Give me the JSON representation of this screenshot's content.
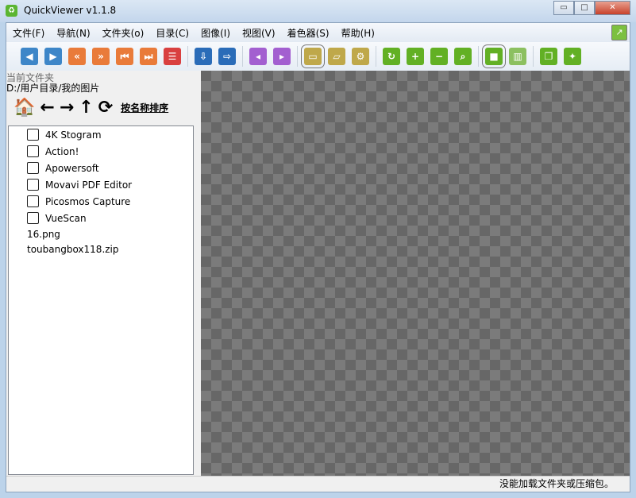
{
  "window": {
    "title": "QuickViewer v1.1.8",
    "minimize": "▭",
    "maximize": "□",
    "close": "✕"
  },
  "menu": [
    "文件(F)",
    "导航(N)",
    "文件夹(o)",
    "目录(C)",
    "图像(I)",
    "视图(V)",
    "着色器(S)",
    "帮助(H)"
  ],
  "menu_end_icon": "↗",
  "toolbar": [
    {
      "name": "prev-image",
      "glyph": "◀",
      "color": "#3d86c8"
    },
    {
      "name": "next-image",
      "glyph": "▶",
      "color": "#3d86c8"
    },
    {
      "name": "fast-back",
      "glyph": "«",
      "color": "#e97b3a"
    },
    {
      "name": "fast-forward",
      "glyph": "»",
      "color": "#e97b3a"
    },
    {
      "name": "first",
      "glyph": "⏮",
      "color": "#e97b3a"
    },
    {
      "name": "last",
      "glyph": "⏭",
      "color": "#e97b3a"
    },
    {
      "name": "catalog",
      "glyph": "☰",
      "color": "#d94040"
    },
    {
      "sep": true
    },
    {
      "name": "open-volume",
      "glyph": "⇩",
      "color": "#2a6cb8"
    },
    {
      "name": "export",
      "glyph": "⇨",
      "color": "#2a6cb8"
    },
    {
      "sep": true
    },
    {
      "name": "prev-volume",
      "glyph": "◂",
      "color": "#a35fd0"
    },
    {
      "name": "next-volume",
      "glyph": "▸",
      "color": "#a35fd0"
    },
    {
      "sep": true
    },
    {
      "name": "folder",
      "glyph": "▭",
      "color": "#bfa84a",
      "sel": true
    },
    {
      "name": "book",
      "glyph": "▱",
      "color": "#bfa84a"
    },
    {
      "name": "settings",
      "glyph": "⚙",
      "color": "#bfa84a"
    },
    {
      "sep": true
    },
    {
      "name": "rotate",
      "glyph": "↻",
      "color": "#62b024"
    },
    {
      "name": "zoom-in",
      "glyph": "+",
      "color": "#62b024"
    },
    {
      "name": "zoom-out",
      "glyph": "−",
      "color": "#62b024"
    },
    {
      "name": "magnifier",
      "glyph": "⌕",
      "color": "#62b024"
    },
    {
      "sep": true
    },
    {
      "name": "single-page",
      "glyph": "■",
      "color": "#62b024",
      "sel": true
    },
    {
      "name": "dual-page",
      "glyph": "▥",
      "color": "#8cc060"
    },
    {
      "sep": true
    },
    {
      "name": "fullscreen",
      "glyph": "❐",
      "color": "#62b024"
    },
    {
      "name": "pin",
      "glyph": "✦",
      "color": "#62b024"
    }
  ],
  "sidebar": {
    "label": "当前文件夹",
    "path": "D:/用户目录/我的图片",
    "nav": {
      "home": "🏠",
      "back": "←",
      "forward": "→",
      "up": "↑",
      "refresh": "⟳",
      "sort": "按名称排序"
    },
    "folders": [
      "4K Stogram",
      "Action!",
      "Apowersoft",
      "Movavi PDF Editor",
      "Picosmos Capture",
      "VueScan"
    ],
    "files": [
      "16.png",
      "toubangbox118.zip"
    ]
  },
  "status": "没能加载文件夹或压缩包。"
}
